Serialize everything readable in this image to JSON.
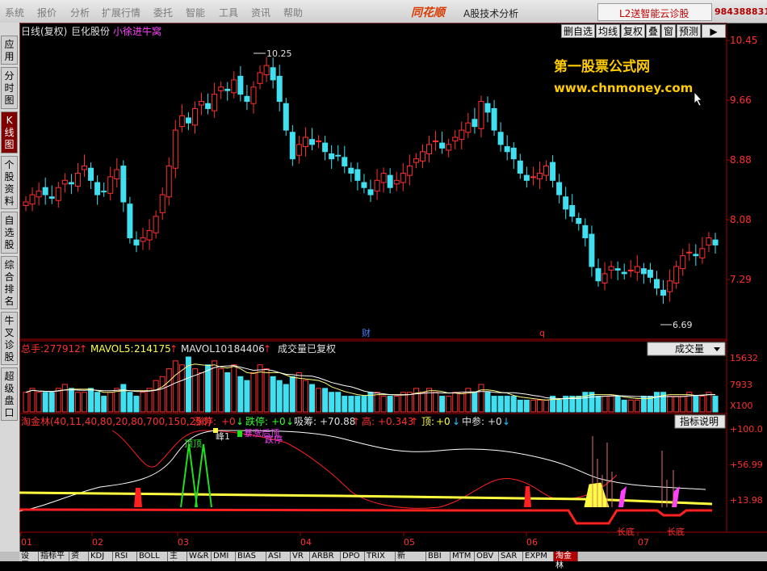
{
  "menubar": {
    "items": [
      "系统",
      "报价",
      "分析",
      "扩展行情",
      "委托",
      "智能",
      "工具",
      "资讯",
      "帮助"
    ],
    "brand": "同花顺",
    "subtitle": "A股技术分析",
    "promo": "L2送智能云诊股",
    "phone": "984388831"
  },
  "left_tabs": [
    {
      "label": "应用",
      "active": false
    },
    {
      "label": "分时图",
      "active": false
    },
    {
      "label": "K线图",
      "active": true
    },
    {
      "label": "个股资料",
      "active": false
    },
    {
      "label": "自选股",
      "active": false
    },
    {
      "label": "综合排名",
      "active": false
    },
    {
      "label": "牛叉诊股",
      "active": false
    },
    {
      "label": "超级盘口",
      "active": false
    }
  ],
  "header": {
    "period": "日线(复权)",
    "stock_name": "巨化股份",
    "author": "小徐进牛窝"
  },
  "toolbar_buttons": [
    "删自选",
    "均线",
    "复权",
    "叠",
    "窗",
    "预测",
    "▶"
  ],
  "watermark": {
    "line1": "第一股票公式网",
    "line2": "www.chnmoney.com"
  },
  "price_panel": {
    "axis_labels": [
      "10.45",
      "9.66",
      "8.88",
      "8.08",
      "7.29"
    ],
    "high_label": "10.25",
    "low_label": "6.69",
    "markers": [
      "财",
      "q"
    ]
  },
  "volume_panel": {
    "total": {
      "label": "总手:",
      "value": "277912"
    },
    "mavol5": {
      "label": "MAVOL5:",
      "value": "214175"
    },
    "mavol10": {
      "label": "MAVOL10:",
      "value": "184406"
    },
    "note": "成交量已复权",
    "select_label": "成交量",
    "axis_labels": [
      "15632",
      "7933",
      "X100"
    ]
  },
  "indicator_panel": {
    "title": "淘金林(40,11,40,80,20,80,700,150,250)",
    "params": [
      {
        "label": "涨停:",
        "value": "+0"
      },
      {
        "label": "跌停:",
        "value": "+0"
      },
      {
        "label": "吸筹:",
        "value": "+70.88"
      },
      {
        "label": "高:",
        "value": "+0.343"
      },
      {
        "label": "顶:",
        "value": "+0"
      },
      {
        "label": "中参:",
        "value": "+0"
      }
    ],
    "explain_button": "指标说明",
    "axis_labels": [
      "+100.0",
      "+56.99",
      "+13.98"
    ],
    "annotations": [
      "顶顶",
      "峰1",
      "暴涨后顶",
      "跌停",
      "长底",
      "长底"
    ]
  },
  "x_axis": [
    "01",
    "02",
    "03",
    "04",
    "05",
    "06",
    "07"
  ],
  "bottom_tabs": [
    "设置",
    "指标平台",
    "资讯",
    "KDJ",
    "RSI",
    "BOLL",
    "主力",
    "W&R",
    "DMI",
    "BIAS",
    "ASI",
    "VR",
    "ARBR",
    "DPO",
    "TRIX",
    "新DMA",
    "BBI",
    "MTM",
    "OBV",
    "SAR",
    "EXPM",
    "淘金林"
  ],
  "active_bottom_tab": "淘金林",
  "chart_data": {
    "type": "candlestick",
    "ylim": [
      6.4,
      10.6
    ],
    "close_series": [
      8.2,
      8.3,
      8.35,
      8.3,
      8.25,
      8.4,
      8.5,
      8.45,
      8.6,
      8.7,
      8.5,
      8.3,
      8.35,
      8.55,
      8.65,
      8.2,
      7.7,
      7.6,
      7.7,
      7.8,
      8.0,
      8.3,
      8.7,
      9.2,
      9.4,
      9.3,
      9.5,
      9.6,
      9.5,
      9.7,
      9.8,
      9.75,
      9.9,
      9.7,
      9.6,
      9.8,
      10.0,
      10.1,
      9.9,
      9.6,
      9.2,
      8.8,
      9.0,
      9.1,
      9.0,
      9.05,
      8.9,
      8.8,
      8.85,
      8.7,
      8.6,
      8.5,
      8.4,
      8.3,
      8.5,
      8.6,
      8.4,
      8.5,
      8.6,
      8.7,
      8.8,
      8.9,
      9.0,
      9.05,
      8.95,
      9.0,
      9.1,
      9.2,
      9.3,
      9.25,
      9.6,
      9.45,
      9.2,
      9.0,
      8.9,
      8.8,
      8.6,
      8.5,
      8.55,
      8.6,
      8.7,
      8.5,
      8.3,
      8.1,
      8.0,
      7.9,
      7.7,
      7.3,
      7.1,
      7.2,
      7.3,
      7.25,
      7.2,
      7.25,
      7.3,
      7.2,
      7.15,
      7.0,
      6.9,
      7.1,
      7.3,
      7.45,
      7.5,
      7.45,
      7.55,
      7.7,
      7.6
    ],
    "volume_series": [
      5,
      6,
      5,
      5,
      5,
      6,
      7,
      6,
      5,
      5,
      6,
      5,
      4,
      5,
      6,
      7,
      5,
      4,
      5,
      6,
      8,
      9,
      11,
      13,
      12,
      14,
      11,
      10,
      12,
      13,
      11,
      10,
      12,
      9,
      8,
      10,
      12,
      11,
      9,
      8,
      7,
      9,
      10,
      8,
      7,
      6,
      6,
      5,
      5,
      4,
      4,
      4,
      4,
      5,
      5,
      4,
      4,
      4,
      5,
      5,
      6,
      5,
      6,
      5,
      4,
      4,
      5,
      5,
      6,
      5,
      7,
      5,
      4,
      4,
      4,
      4,
      3,
      3,
      3,
      3,
      3,
      4,
      3,
      4,
      4,
      4,
      5,
      5,
      4,
      4,
      4,
      4,
      3,
      3,
      3,
      4,
      4,
      5,
      5,
      4,
      4,
      4,
      5,
      4,
      4,
      5,
      4
    ]
  }
}
